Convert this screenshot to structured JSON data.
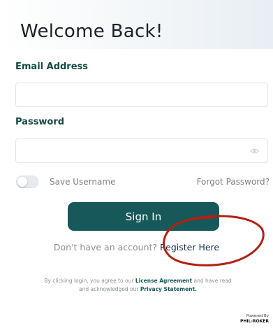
{
  "header": {
    "title": "Welcome Back!"
  },
  "form": {
    "email_label": "Email Address",
    "email_value": "",
    "password_label": "Password",
    "password_value": "",
    "save_username_label": "Save Username",
    "save_username_on": false,
    "forgot_password_label": "Forgot Password?",
    "signin_label": "Sign In"
  },
  "register": {
    "prompt": "Don't have an account?",
    "link_label": "Register Here"
  },
  "terms": {
    "line1_prefix": "By clicking login, you agree to our",
    "license_label": "License Agreement",
    "line1_suffix": "and have read",
    "line2_prefix": "and acknowledged our",
    "privacy_label": "Privacy Statement."
  },
  "footer": {
    "powered_by": "Powered By",
    "brand": "PHIL-ROKER"
  },
  "icons": {
    "password_visibility": "eye-icon"
  },
  "colors": {
    "accent": "#17585a",
    "label": "#164a45",
    "annotation": "#b32012"
  }
}
